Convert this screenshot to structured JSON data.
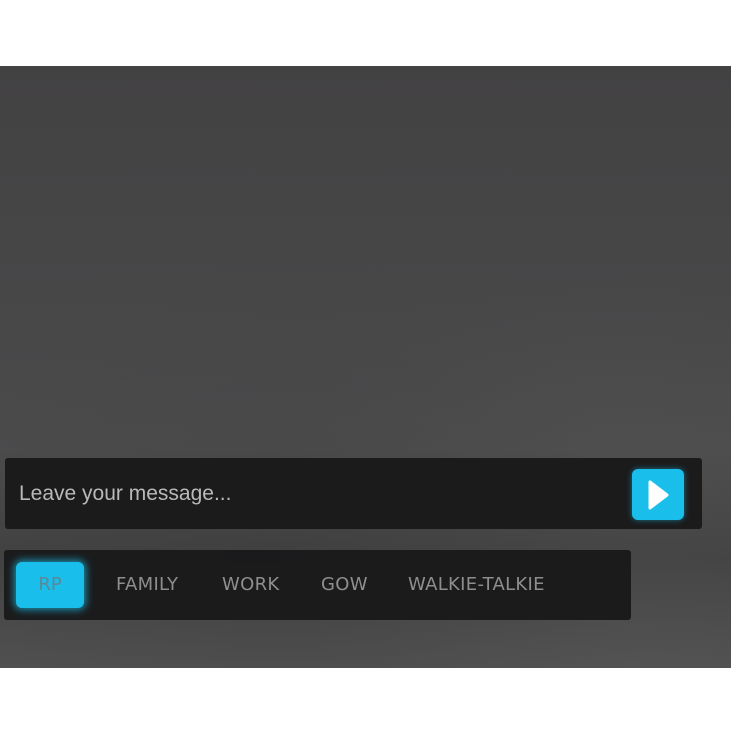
{
  "message": {
    "placeholder": "Leave your message...",
    "value": ""
  },
  "send_button": {
    "icon": "play-triangle-icon",
    "color": "#19bfea"
  },
  "tabs": [
    {
      "label": "RP",
      "active": true
    },
    {
      "label": "FAMILY",
      "active": false
    },
    {
      "label": "WORK",
      "active": false
    },
    {
      "label": "GOW",
      "active": false
    },
    {
      "label": "WALKIE-TALKIE",
      "active": false
    }
  ],
  "colors": {
    "accent": "#19bfea",
    "panel": "#181819",
    "background": "#474748"
  }
}
